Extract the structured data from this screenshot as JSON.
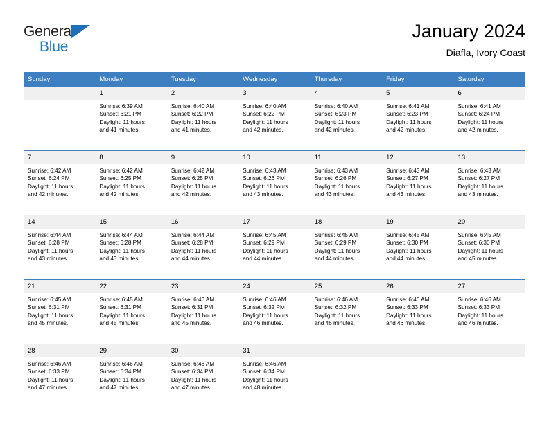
{
  "brand": {
    "word1": "General",
    "word2": "Blue",
    "triangle_color": "#1d70b8",
    "word2_color": "#1b7ac7"
  },
  "header": {
    "title": "January 2024",
    "subtitle": "Diafla, Ivory Coast"
  },
  "theme": {
    "header_blue": "#3d7fc1",
    "daynum_bg": "#f0f0f0",
    "cell_bg": "#ffffff"
  },
  "columns": [
    "Sunday",
    "Monday",
    "Tuesday",
    "Wednesday",
    "Thursday",
    "Friday",
    "Saturday"
  ],
  "weeks": [
    {
      "days": [
        {
          "num": "",
          "sunrise": "",
          "sunset": "",
          "daylight1": "",
          "daylight2": ""
        },
        {
          "num": "1",
          "sunrise": "Sunrise: 6:39 AM",
          "sunset": "Sunset: 6:21 PM",
          "daylight1": "Daylight: 11 hours",
          "daylight2": "and 41 minutes."
        },
        {
          "num": "2",
          "sunrise": "Sunrise: 6:40 AM",
          "sunset": "Sunset: 6:22 PM",
          "daylight1": "Daylight: 11 hours",
          "daylight2": "and 41 minutes."
        },
        {
          "num": "3",
          "sunrise": "Sunrise: 6:40 AM",
          "sunset": "Sunset: 6:22 PM",
          "daylight1": "Daylight: 11 hours",
          "daylight2": "and 42 minutes."
        },
        {
          "num": "4",
          "sunrise": "Sunrise: 6:40 AM",
          "sunset": "Sunset: 6:23 PM",
          "daylight1": "Daylight: 11 hours",
          "daylight2": "and 42 minutes."
        },
        {
          "num": "5",
          "sunrise": "Sunrise: 6:41 AM",
          "sunset": "Sunset: 6:23 PM",
          "daylight1": "Daylight: 11 hours",
          "daylight2": "and 42 minutes."
        },
        {
          "num": "6",
          "sunrise": "Sunrise: 6:41 AM",
          "sunset": "Sunset: 6:24 PM",
          "daylight1": "Daylight: 11 hours",
          "daylight2": "and 42 minutes."
        }
      ]
    },
    {
      "days": [
        {
          "num": "7",
          "sunrise": "Sunrise: 6:42 AM",
          "sunset": "Sunset: 6:24 PM",
          "daylight1": "Daylight: 11 hours",
          "daylight2": "and 42 minutes."
        },
        {
          "num": "8",
          "sunrise": "Sunrise: 6:42 AM",
          "sunset": "Sunset: 6:25 PM",
          "daylight1": "Daylight: 11 hours",
          "daylight2": "and 42 minutes."
        },
        {
          "num": "9",
          "sunrise": "Sunrise: 6:42 AM",
          "sunset": "Sunset: 6:25 PM",
          "daylight1": "Daylight: 11 hours",
          "daylight2": "and 42 minutes."
        },
        {
          "num": "10",
          "sunrise": "Sunrise: 6:43 AM",
          "sunset": "Sunset: 6:26 PM",
          "daylight1": "Daylight: 11 hours",
          "daylight2": "and 43 minutes."
        },
        {
          "num": "11",
          "sunrise": "Sunrise: 6:43 AM",
          "sunset": "Sunset: 6:26 PM",
          "daylight1": "Daylight: 11 hours",
          "daylight2": "and 43 minutes."
        },
        {
          "num": "12",
          "sunrise": "Sunrise: 6:43 AM",
          "sunset": "Sunset: 6:27 PM",
          "daylight1": "Daylight: 11 hours",
          "daylight2": "and 43 minutes."
        },
        {
          "num": "13",
          "sunrise": "Sunrise: 6:43 AM",
          "sunset": "Sunset: 6:27 PM",
          "daylight1": "Daylight: 11 hours",
          "daylight2": "and 43 minutes."
        }
      ]
    },
    {
      "days": [
        {
          "num": "14",
          "sunrise": "Sunrise: 6:44 AM",
          "sunset": "Sunset: 6:28 PM",
          "daylight1": "Daylight: 11 hours",
          "daylight2": "and 43 minutes."
        },
        {
          "num": "15",
          "sunrise": "Sunrise: 6:44 AM",
          "sunset": "Sunset: 6:28 PM",
          "daylight1": "Daylight: 11 hours",
          "daylight2": "and 43 minutes."
        },
        {
          "num": "16",
          "sunrise": "Sunrise: 6:44 AM",
          "sunset": "Sunset: 6:28 PM",
          "daylight1": "Daylight: 11 hours",
          "daylight2": "and 44 minutes."
        },
        {
          "num": "17",
          "sunrise": "Sunrise: 6:45 AM",
          "sunset": "Sunset: 6:29 PM",
          "daylight1": "Daylight: 11 hours",
          "daylight2": "and 44 minutes."
        },
        {
          "num": "18",
          "sunrise": "Sunrise: 6:45 AM",
          "sunset": "Sunset: 6:29 PM",
          "daylight1": "Daylight: 11 hours",
          "daylight2": "and 44 minutes."
        },
        {
          "num": "19",
          "sunrise": "Sunrise: 6:45 AM",
          "sunset": "Sunset: 6:30 PM",
          "daylight1": "Daylight: 11 hours",
          "daylight2": "and 44 minutes."
        },
        {
          "num": "20",
          "sunrise": "Sunrise: 6:45 AM",
          "sunset": "Sunset: 6:30 PM",
          "daylight1": "Daylight: 11 hours",
          "daylight2": "and 45 minutes."
        }
      ]
    },
    {
      "days": [
        {
          "num": "21",
          "sunrise": "Sunrise: 6:45 AM",
          "sunset": "Sunset: 6:31 PM",
          "daylight1": "Daylight: 11 hours",
          "daylight2": "and 45 minutes."
        },
        {
          "num": "22",
          "sunrise": "Sunrise: 6:45 AM",
          "sunset": "Sunset: 6:31 PM",
          "daylight1": "Daylight: 11 hours",
          "daylight2": "and 45 minutes."
        },
        {
          "num": "23",
          "sunrise": "Sunrise: 6:46 AM",
          "sunset": "Sunset: 6:31 PM",
          "daylight1": "Daylight: 11 hours",
          "daylight2": "and 45 minutes."
        },
        {
          "num": "24",
          "sunrise": "Sunrise: 6:46 AM",
          "sunset": "Sunset: 6:32 PM",
          "daylight1": "Daylight: 11 hours",
          "daylight2": "and 46 minutes."
        },
        {
          "num": "25",
          "sunrise": "Sunrise: 6:46 AM",
          "sunset": "Sunset: 6:32 PM",
          "daylight1": "Daylight: 11 hours",
          "daylight2": "and 46 minutes."
        },
        {
          "num": "26",
          "sunrise": "Sunrise: 6:46 AM",
          "sunset": "Sunset: 6:33 PM",
          "daylight1": "Daylight: 11 hours",
          "daylight2": "and 46 minutes."
        },
        {
          "num": "27",
          "sunrise": "Sunrise: 6:46 AM",
          "sunset": "Sunset: 6:33 PM",
          "daylight1": "Daylight: 11 hours",
          "daylight2": "and 46 minutes."
        }
      ]
    },
    {
      "days": [
        {
          "num": "28",
          "sunrise": "Sunrise: 6:46 AM",
          "sunset": "Sunset: 6:33 PM",
          "daylight1": "Daylight: 11 hours",
          "daylight2": "and 47 minutes."
        },
        {
          "num": "29",
          "sunrise": "Sunrise: 6:46 AM",
          "sunset": "Sunset: 6:34 PM",
          "daylight1": "Daylight: 11 hours",
          "daylight2": "and 47 minutes."
        },
        {
          "num": "30",
          "sunrise": "Sunrise: 6:46 AM",
          "sunset": "Sunset: 6:34 PM",
          "daylight1": "Daylight: 11 hours",
          "daylight2": "and 47 minutes."
        },
        {
          "num": "31",
          "sunrise": "Sunrise: 6:46 AM",
          "sunset": "Sunset: 6:34 PM",
          "daylight1": "Daylight: 11 hours",
          "daylight2": "and 48 minutes."
        },
        {
          "num": "",
          "sunrise": "",
          "sunset": "",
          "daylight1": "",
          "daylight2": ""
        },
        {
          "num": "",
          "sunrise": "",
          "sunset": "",
          "daylight1": "",
          "daylight2": ""
        },
        {
          "num": "",
          "sunrise": "",
          "sunset": "",
          "daylight1": "",
          "daylight2": ""
        }
      ]
    }
  ]
}
